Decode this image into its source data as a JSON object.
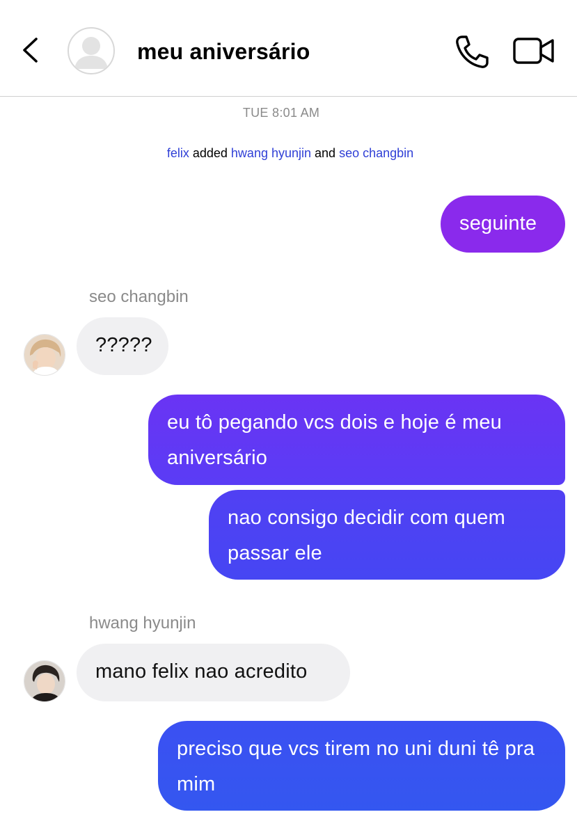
{
  "header": {
    "title": "meu aniversário",
    "back_icon": "chevron-left-icon",
    "avatar_icon": "group-avatar-placeholder-icon",
    "call_icon": "phone-icon",
    "video_icon": "video-camera-icon"
  },
  "timestamp": "TUE 8:01 AM",
  "system_message": {
    "actor": "felix",
    "verb": "added",
    "user1": "hwang hyunjin",
    "conjunction": "and",
    "user2": "seo changbin"
  },
  "messages": [
    {
      "from": "me",
      "text": "seguinte"
    },
    {
      "from": "seo changbin",
      "sender_label": "seo changbin",
      "text": "?????"
    },
    {
      "from": "me",
      "text": "eu tô pegando vcs dois e hoje é meu aniversário"
    },
    {
      "from": "me",
      "text": "nao consigo decidir com quem passar ele"
    },
    {
      "from": "hwang hyunjin",
      "sender_label": "hwang hyunjin",
      "text": "mano felix nao acredito"
    },
    {
      "from": "me",
      "text": "preciso que vcs tirem no uni duni tê pra mim"
    }
  ],
  "colors": {
    "outgoing_gradient_top": "#8a2be8",
    "outgoing_gradient_bottom": "#3355f0",
    "incoming_bubble": "#f0f0f2",
    "link_name": "#2f3fd6",
    "muted_text": "#8a8a8a"
  }
}
